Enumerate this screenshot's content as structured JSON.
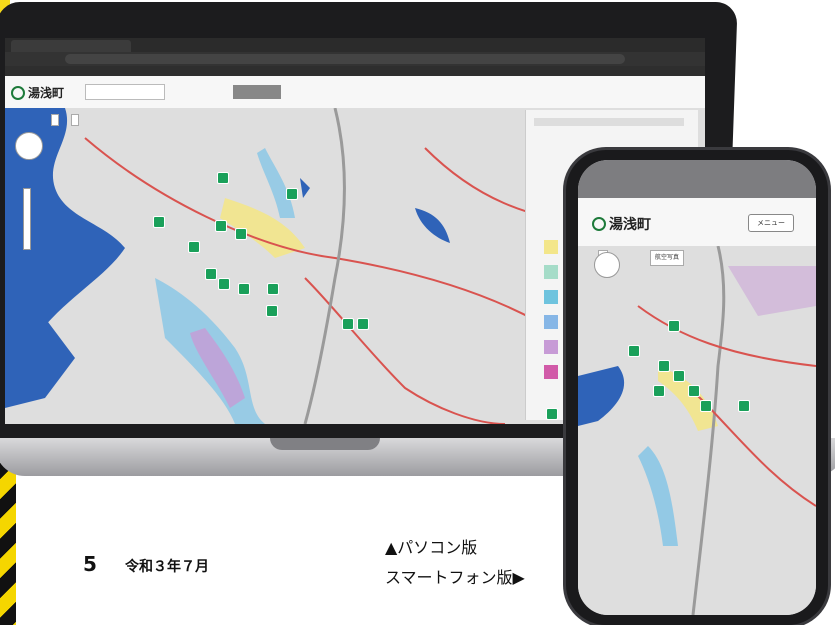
{
  "captions": {
    "pc_version": "▲パソコン版",
    "smartphone_version": "スマートフォン版▶"
  },
  "footer": {
    "page_number": "5",
    "date": "令和３年７月"
  },
  "laptop": {
    "site_logo": "湯浅町",
    "search_placeholder": "",
    "panel_title": "",
    "map_tabs": [
      "",
      ""
    ]
  },
  "phone": {
    "site_logo": "湯浅町",
    "menu_button": "メニュー",
    "map_tabs": [
      "",
      "航空写真"
    ]
  },
  "colors": {
    "sea": "#2f63b8",
    "road": "#d9534f",
    "shelter": "#1aa05a",
    "flood_yellow": "#f3e68a",
    "flood_blue": "#86c6e6",
    "flood_purple": "#c79bd6",
    "flood_pink": "#d15aa8"
  },
  "icons": [
    "shelter-icon",
    "compass-icon",
    "zoom-control-icon"
  ]
}
